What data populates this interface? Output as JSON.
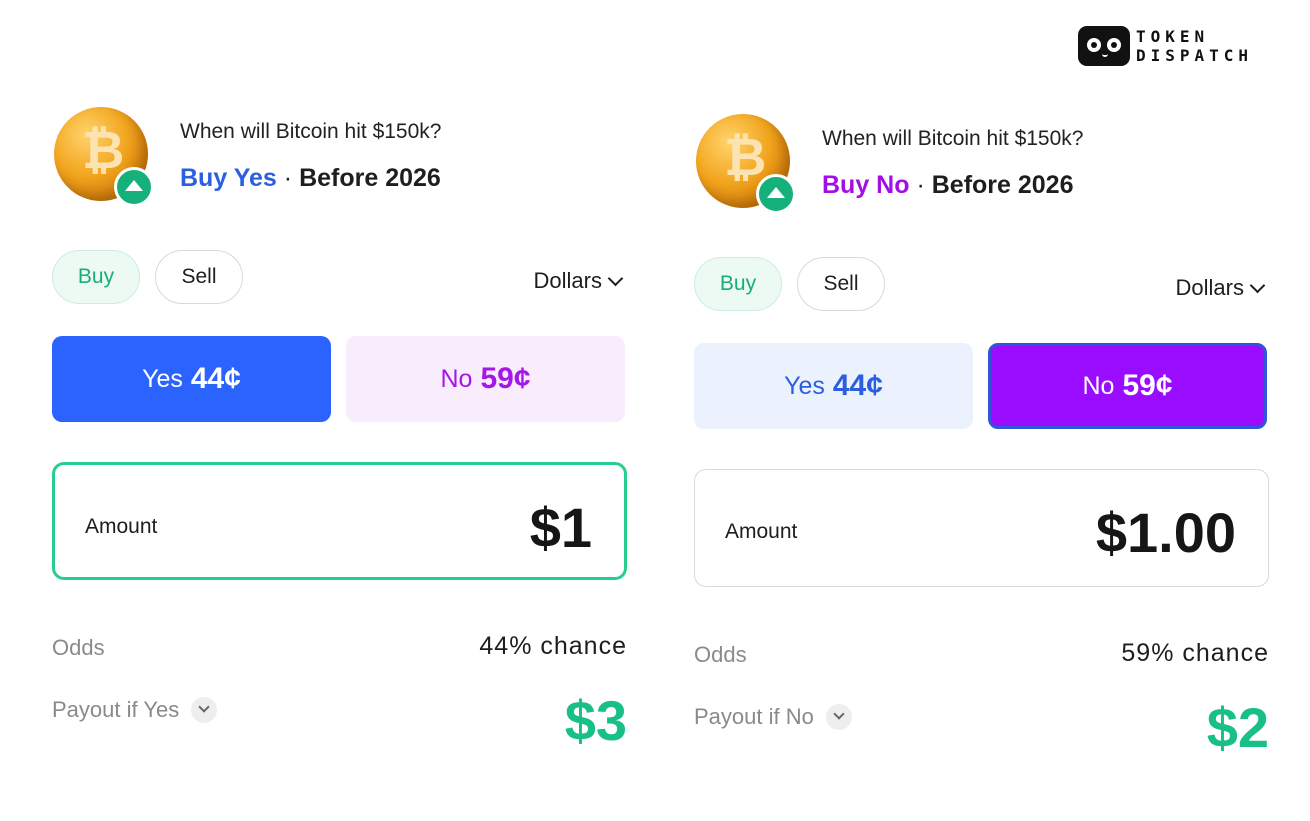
{
  "brand": {
    "line1": "TOKEN",
    "line2": "DISPATCH"
  },
  "colors": {
    "yes_blue": "#2b63ff",
    "no_purple": "#9a0cff",
    "green": "#18c085"
  },
  "panels": [
    {
      "question": "When will Bitcoin hit $150k?",
      "action": "Buy Yes",
      "separator": "·",
      "deadline": "Before 2026",
      "tabs": {
        "buy": "Buy",
        "sell": "Sell"
      },
      "currency": "Dollars",
      "outcomes": {
        "yes_label": "Yes",
        "yes_price": "44¢",
        "no_label": "No",
        "no_price": "59¢",
        "selected": "yes"
      },
      "amount_label": "Amount",
      "amount_value": "$1",
      "odds_label": "Odds",
      "odds_value": "44% chance",
      "payout_label": "Payout if Yes",
      "payout_value": "$3"
    },
    {
      "question": "When will Bitcoin hit $150k?",
      "action": "Buy No",
      "separator": "·",
      "deadline": "Before 2026",
      "tabs": {
        "buy": "Buy",
        "sell": "Sell"
      },
      "currency": "Dollars",
      "outcomes": {
        "yes_label": "Yes",
        "yes_price": "44¢",
        "no_label": "No",
        "no_price": "59¢",
        "selected": "no"
      },
      "amount_label": "Amount",
      "amount_value": "$1.00",
      "odds_label": "Odds",
      "odds_value": "59% chance",
      "payout_label": "Payout if No",
      "payout_value": "$2"
    }
  ]
}
